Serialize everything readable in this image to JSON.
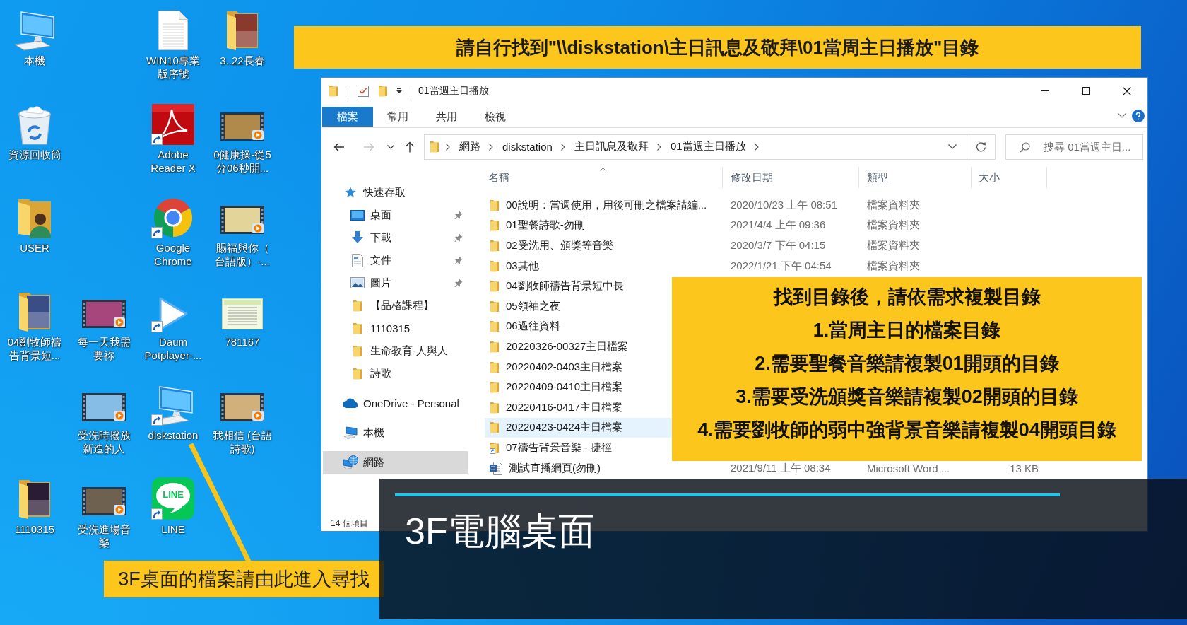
{
  "desktop": {
    "columns": [
      [
        {
          "label": "本機",
          "kind": "computer",
          "shortcut": false
        },
        {
          "label": "資源回收筒",
          "kind": "recycle-bin",
          "shortcut": false
        },
        {
          "label": "USER",
          "kind": "user-folder",
          "shortcut": false
        },
        {
          "label": "04劉牧師禱告背景短...",
          "kind": "photo-folder",
          "shortcut": false
        },
        {
          "label": "1110315",
          "kind": "photo-folder",
          "shortcut": false
        }
      ],
      [
        {
          "label": "每一天我需要祢",
          "kind": "video",
          "shortcut": false
        },
        {
          "label": "受洗時撥放新造的人",
          "kind": "video",
          "shortcut": false
        },
        {
          "label": "受洗進場音樂",
          "kind": "video",
          "shortcut": false
        }
      ],
      [
        {
          "label": "WIN10專業版序號",
          "kind": "text-file",
          "shortcut": false
        },
        {
          "label": "Adobe Reader X",
          "kind": "pdf-reader",
          "shortcut": true
        },
        {
          "label": "Google Chrome",
          "kind": "browser",
          "shortcut": true
        },
        {
          "label": "Daum Potplayer-...",
          "kind": "player",
          "shortcut": true
        },
        {
          "label": "diskstation",
          "kind": "computer",
          "shortcut": true
        },
        {
          "label": "LINE",
          "kind": "chat-app",
          "shortcut": true,
          "logo_text": "LINE"
        }
      ],
      [
        {
          "label": "3..22長春",
          "kind": "photo-folder",
          "shortcut": false
        },
        {
          "label": "0健康操-從5分06秒開...",
          "kind": "video",
          "shortcut": false
        },
        {
          "label": "賜福與你（台語版）-...",
          "kind": "video",
          "shortcut": false
        },
        {
          "label": "781167",
          "kind": "image",
          "shortcut": false
        },
        {
          "label": "我相信 (台語詩歌)",
          "kind": "video",
          "shortcut": false
        }
      ]
    ]
  },
  "explorer": {
    "title": "01當週主日播放",
    "ribbon_tabs": [
      {
        "label": "檔案",
        "selected": true
      },
      {
        "label": "常用",
        "selected": false
      },
      {
        "label": "共用",
        "selected": false
      },
      {
        "label": "檢視",
        "selected": false
      }
    ],
    "nav_buttons": [
      {
        "kind": "back",
        "disabled": false
      },
      {
        "kind": "forward",
        "disabled": true
      },
      {
        "kind": "recent",
        "disabled": false
      },
      {
        "kind": "up",
        "disabled": false
      }
    ],
    "breadcrumbs": [
      "網路",
      "diskstation",
      "主日訊息及敬拜",
      "01當週主日播放"
    ],
    "search": {
      "placeholder": "搜尋 01當週主日..."
    },
    "nav": [
      {
        "label": "快速存取",
        "kind": "star",
        "selected": false,
        "children": [
          {
            "label": "桌面",
            "kind": "desktop",
            "pinned": true,
            "selected": false
          },
          {
            "label": "下載",
            "kind": "download",
            "pinned": true,
            "selected": false
          },
          {
            "label": "文件",
            "kind": "document",
            "pinned": true,
            "selected": false
          },
          {
            "label": "圖片",
            "kind": "picture",
            "pinned": true,
            "selected": false
          },
          {
            "label": "【品格課程】",
            "kind": "folder",
            "pinned": false,
            "selected": false
          },
          {
            "label": "1110315",
            "kind": "folder",
            "pinned": false,
            "selected": false
          },
          {
            "label": "生命教育-人與人",
            "kind": "folder",
            "pinned": false,
            "selected": false
          },
          {
            "label": "詩歌",
            "kind": "folder",
            "pinned": false,
            "selected": false
          }
        ]
      },
      {
        "label": "OneDrive - Personal",
        "kind": "cloud",
        "selected": false
      },
      {
        "label": "本機",
        "kind": "computer",
        "selected": false
      },
      {
        "label": "網路",
        "kind": "network",
        "selected": true
      }
    ],
    "columns": [
      {
        "label": "名稱",
        "sorted": true
      },
      {
        "label": "修改日期",
        "sorted": false
      },
      {
        "label": "類型",
        "sorted": false
      },
      {
        "label": "大小",
        "sorted": false
      }
    ],
    "files": [
      {
        "name": "00說明：當週使用，用後可刪之檔案請編...",
        "kind": "folder",
        "modified": "2020/10/23 上午 08:51",
        "type": "檔案資料夾",
        "selected": false
      },
      {
        "name": "01聖餐詩歌-勿刪",
        "kind": "folder",
        "modified": "2021/4/4 上午 09:36",
        "type": "檔案資料夾",
        "selected": false
      },
      {
        "name": "02受洗用、頒獎等音樂",
        "kind": "folder",
        "modified": "2020/3/7 下午 04:15",
        "type": "檔案資料夾",
        "selected": false
      },
      {
        "name": "03其他",
        "kind": "folder",
        "modified": "2022/1/21 下午 04:54",
        "type": "檔案資料夾",
        "selected": false
      },
      {
        "name": "04劉牧師禱告背景短中長",
        "kind": "folder",
        "selected": false
      },
      {
        "name": "05領袖之夜",
        "kind": "folder",
        "selected": false
      },
      {
        "name": "06過往資料",
        "kind": "folder",
        "selected": false
      },
      {
        "name": "20220326-00327主日檔案",
        "kind": "folder",
        "selected": false
      },
      {
        "name": "20220402-0403主日檔案",
        "kind": "folder",
        "selected": false
      },
      {
        "name": "20220409-0410主日檔案",
        "kind": "folder",
        "selected": false
      },
      {
        "name": "20220416-0417主日檔案",
        "kind": "folder",
        "selected": false
      },
      {
        "name": "20220423-0424主日檔案",
        "kind": "folder",
        "selected": true
      },
      {
        "name": "07禱告背景音樂 - 捷徑",
        "kind": "shortcut",
        "selected": false
      },
      {
        "name": "測試直播網頁(勿刪)",
        "kind": "word-document",
        "modified": "2021/9/11 上午 08:34",
        "type": "Microsoft Word ...",
        "size": "13 KB",
        "selected": false
      }
    ],
    "status": "14 個項目"
  },
  "top_note": {
    "text": "請自行找到\"\\\\diskstation\\主日訊息及敬拜\\01當周主日播放\"目錄"
  },
  "instructions": {
    "lines": [
      "找到目錄後，請依需求複製目錄",
      "1.當周主日的檔案目錄",
      "2.需要聖餐音樂請複製01開頭的目錄",
      "3.需要受洗頒獎音樂請複製02開頭的目錄",
      "4.需要劉牧師的弱中強背景音樂請複製04開頭目錄"
    ]
  },
  "callout": {
    "text": "3F桌面的檔案請由此進入尋找"
  },
  "caption": {
    "title": "3F電腦桌面"
  }
}
